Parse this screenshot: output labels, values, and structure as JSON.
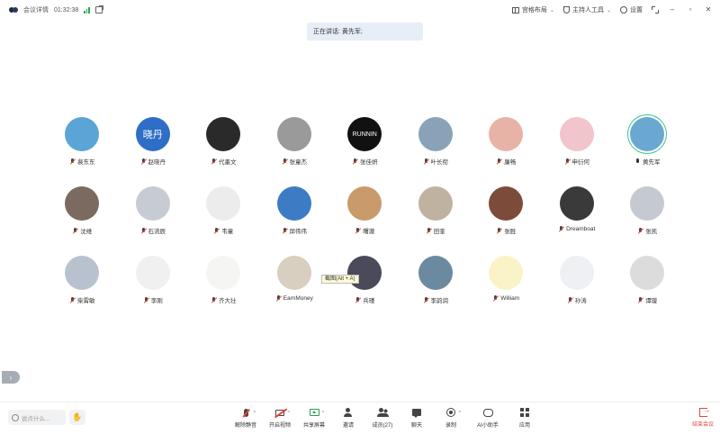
{
  "topbar": {
    "meeting_info": "会议详情",
    "timer": "01:32:38",
    "layout_label": "宫格布局",
    "host_tools_label": "主持人工具",
    "settings_label": "设置"
  },
  "speaking_banner": "正在讲话: 黄先军;",
  "participants": [
    {
      "name": "裴东东",
      "mic": "off",
      "bg": "#5aa5d6",
      "avatar_text": ""
    },
    {
      "name": "赵晓丹",
      "mic": "off",
      "bg": "#2f6ec6",
      "avatar_text": "晓丹"
    },
    {
      "name": "代墨文",
      "mic": "off",
      "bg": "#2a2a2a",
      "avatar_text": ""
    },
    {
      "name": "张童杰",
      "mic": "off",
      "bg": "#9a9a9a",
      "avatar_text": ""
    },
    {
      "name": "张佳妍",
      "mic": "off",
      "bg": "#111111",
      "avatar_text": "RUNNIN"
    },
    {
      "name": "叶长衔",
      "mic": "off",
      "bg": "#8aa2b8",
      "avatar_text": ""
    },
    {
      "name": "廉畅",
      "mic": "off",
      "bg": "#e8b3a7",
      "avatar_text": ""
    },
    {
      "name": "申衍何",
      "mic": "off",
      "bg": "#f2c4cc",
      "avatar_text": ""
    },
    {
      "name": "黄先军",
      "mic": "on",
      "bg": "#6aa8d2",
      "avatar_text": "",
      "active": true
    },
    {
      "name": "沈维",
      "mic": "off",
      "bg": "#7a6a60",
      "avatar_text": ""
    },
    {
      "name": "石流辰",
      "mic": "off",
      "bg": "#c7cbd3",
      "avatar_text": ""
    },
    {
      "name": "韦童",
      "mic": "off",
      "bg": "#ececec",
      "avatar_text": ""
    },
    {
      "name": "邱伟伟",
      "mic": "off",
      "bg": "#3d7cc4",
      "avatar_text": ""
    },
    {
      "name": "曙澈",
      "mic": "off",
      "bg": "#c99a6a",
      "avatar_text": ""
    },
    {
      "name": "田奎",
      "mic": "off",
      "bg": "#bfb2a0",
      "avatar_text": ""
    },
    {
      "name": "张胜",
      "mic": "off",
      "bg": "#7d4b3a",
      "avatar_text": ""
    },
    {
      "name": "Dreamboat",
      "mic": "off",
      "bg": "#3a3a3a",
      "avatar_text": ""
    },
    {
      "name": "张凯",
      "mic": "off",
      "bg": "#c5c9d0",
      "avatar_text": ""
    },
    {
      "name": "柴霄敏",
      "mic": "off",
      "bg": "#b8c2cf",
      "avatar_text": ""
    },
    {
      "name": "李刚",
      "mic": "off",
      "bg": "#f0f0f0",
      "avatar_text": ""
    },
    {
      "name": "齐大壮",
      "mic": "off",
      "bg": "#f5f5f3",
      "avatar_text": ""
    },
    {
      "name": "EarnMoney",
      "mic": "off",
      "bg": "#d8cfc0",
      "avatar_text": ""
    },
    {
      "name": "兵瑾",
      "mic": "off",
      "bg": "#4a4a5a",
      "avatar_text": ""
    },
    {
      "name": "李韵润",
      "mic": "off",
      "bg": "#6b8aa0",
      "avatar_text": ""
    },
    {
      "name": "William",
      "mic": "off",
      "bg": "#fbf3c8",
      "avatar_text": ""
    },
    {
      "name": "孙涛",
      "mic": "off",
      "bg": "#eef0f3",
      "avatar_text": ""
    },
    {
      "name": "谭璇",
      "mic": "off",
      "bg": "#dcdcdc",
      "avatar_text": ""
    }
  ],
  "tooltip": "截图(Alt + A)",
  "chat": {
    "placeholder": "说点什么..."
  },
  "toolbar": {
    "unmute": "解除静音",
    "start_video": "开启视频",
    "share_screen": "共享屏幕",
    "invite": "邀请",
    "members": "成员(27)",
    "chat": "聊天",
    "record": "录制",
    "ai_assistant": "AI小助手",
    "apps": "应用",
    "end_meeting": "结束会议"
  },
  "colors": {
    "accent_red": "#e0463d",
    "active_ring": "#3cc48a",
    "share_green": "#2e9b5a",
    "banner_bg": "#e7eef8"
  }
}
